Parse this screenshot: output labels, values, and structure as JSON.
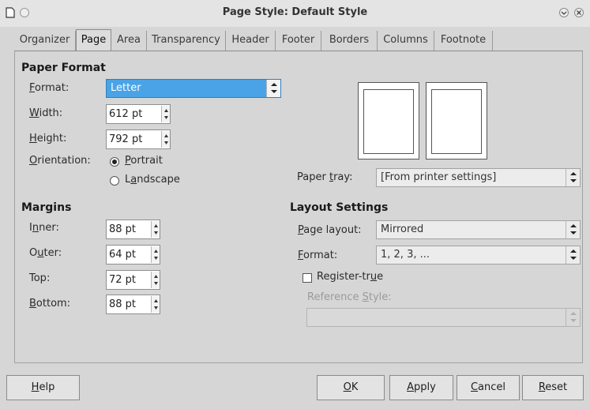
{
  "window": {
    "title": "Page Style: Default Style",
    "icons": [
      "document-icon",
      "circle-icon",
      "minimize-icon",
      "close-icon"
    ]
  },
  "tabs": [
    {
      "label": "Organizer"
    },
    {
      "label": "Page"
    },
    {
      "label": "Area"
    },
    {
      "label": "Transparency"
    },
    {
      "label": "Header"
    },
    {
      "label": "Footer"
    },
    {
      "label": "Borders"
    },
    {
      "label": "Columns"
    },
    {
      "label": "Footnote"
    }
  ],
  "active_tab": "Page",
  "paper_format": {
    "heading": "Paper Format",
    "format_label_pre": "",
    "format_label_u": "F",
    "format_label_post": "ormat:",
    "format_value": "Letter",
    "width_label_u": "W",
    "width_label_post": "idth:",
    "width_value": "612 pt",
    "height_label_u": "H",
    "height_label_post": "eight:",
    "height_value": "792 pt",
    "orientation_label_u": "O",
    "orientation_label_post": "rientation:",
    "portrait_u": "P",
    "portrait_post": "ortrait",
    "landscape_pre": "L",
    "landscape_u": "a",
    "landscape_post": "ndscape",
    "orientation_selected": "Portrait"
  },
  "paper_tray": {
    "label_pre": "Paper ",
    "label_u": "t",
    "label_post": "ray:",
    "value": "[From printer settings]"
  },
  "margins": {
    "heading": "Margins",
    "inner_label_pre": "I",
    "inner_label_u": "n",
    "inner_label_post": "ner:",
    "inner_value": "88 pt",
    "outer_label_pre": "O",
    "outer_label_u": "u",
    "outer_label_post": "ter:",
    "outer_value": "64 pt",
    "top_label": "Top:",
    "top_value": "72 pt",
    "bottom_label_u": "B",
    "bottom_label_post": "ottom:",
    "bottom_value": "88 pt"
  },
  "layout_settings": {
    "heading": "Layout Settings",
    "page_layout_label_u": "P",
    "page_layout_label_post": "age layout:",
    "page_layout_value": "Mirrored",
    "format_label_u": "F",
    "format_label_post": "ormat:",
    "format_value": "1, 2, 3, ...",
    "register_true_pre": "Register-tr",
    "register_true_u": "u",
    "register_true_post": "e",
    "register_true_checked": false,
    "reference_style_pre": "Reference ",
    "reference_style_u": "S",
    "reference_style_post": "tyle:",
    "reference_style_value": ""
  },
  "buttons": {
    "help_u": "H",
    "help_post": "elp",
    "ok_u": "O",
    "ok_post": "K",
    "apply_u": "A",
    "apply_post": "pply",
    "cancel_u": "C",
    "cancel_post": "ancel",
    "reset_u": "R",
    "reset_post": "eset"
  },
  "colors": {
    "selection": "#4aa3e6",
    "background": "#d6d6d6"
  }
}
